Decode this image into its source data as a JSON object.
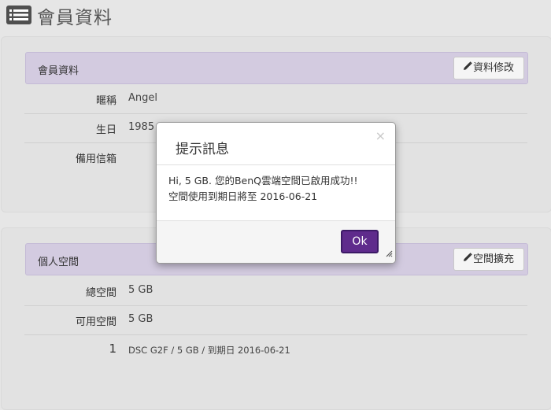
{
  "page": {
    "title": "會員資料",
    "icon": "list-icon"
  },
  "profile_panel": {
    "header": "會員資料",
    "edit_button": "資料修改",
    "rows": [
      {
        "label": "暱稱",
        "value": "Angel"
      },
      {
        "label": "生日",
        "value": "1985"
      },
      {
        "label": "備用信箱",
        "value": ""
      }
    ]
  },
  "space_panel": {
    "header": "個人空間",
    "edit_button": "空間擴充",
    "rows": [
      {
        "label": "總空間",
        "value": "5 GB"
      },
      {
        "label": "可用空間",
        "value": "5 GB"
      },
      {
        "label": "1",
        "value": "DSC G2F / 5 GB / 到期日 2016-06-21"
      }
    ]
  },
  "modal": {
    "title": "提示訊息",
    "close": "×",
    "message_line1": "Hi, 5 GB. 您的BenQ雲端空間已啟用成功!!",
    "message_line2": "空間使用到期日將至 2016-06-21",
    "ok_button": "Ok"
  },
  "colors": {
    "panel_header_bg": "#d3cbe0",
    "ok_button_bg": "#5f2b8c",
    "page_bg": "#e6e6e6"
  }
}
